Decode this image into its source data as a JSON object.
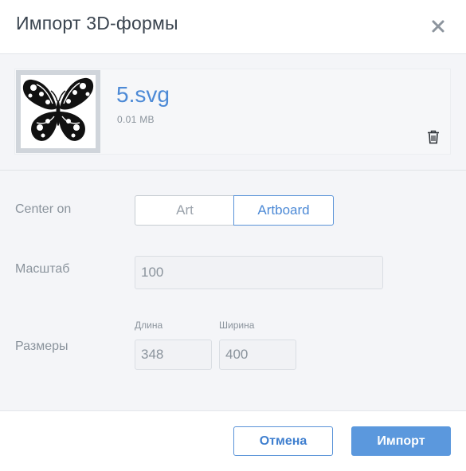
{
  "dialog": {
    "title": "Импорт 3D-формы",
    "close_icon": "close-icon"
  },
  "file": {
    "name": "5.svg",
    "size": "0.01 MB",
    "thumbnail_icon": "butterfly-thumbnail",
    "delete_icon": "trash-icon"
  },
  "form": {
    "center_on": {
      "label": "Center on",
      "options": [
        "Art",
        "Artboard"
      ],
      "selected": "Artboard"
    },
    "scale": {
      "label": "Масштаб",
      "value": "100"
    },
    "dimensions": {
      "label": "Размеры",
      "length_label": "Длина",
      "length_value": "348",
      "width_label": "Ширина",
      "width_value": "400"
    }
  },
  "footer": {
    "cancel_label": "Отмена",
    "import_label": "Импорт"
  },
  "colors": {
    "accent": "#4d8ad6",
    "primary_button": "#5b98dd",
    "body_background": "#f4f5f8"
  }
}
